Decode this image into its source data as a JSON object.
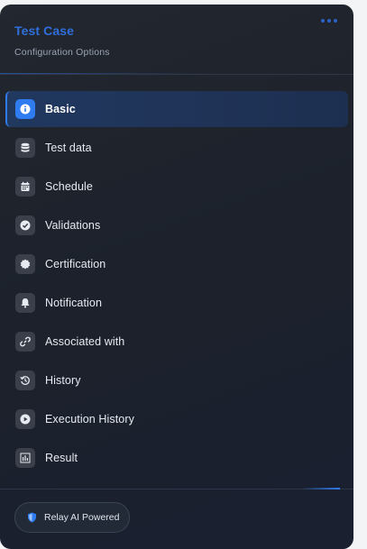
{
  "header": {
    "title": "Test Case",
    "subtitle": "Configuration Options",
    "more_icon": "more-horizontal-icon"
  },
  "menu": {
    "active_index": 0,
    "items": [
      {
        "label": "Basic",
        "icon": "info-icon"
      },
      {
        "label": "Test data",
        "icon": "database-icon"
      },
      {
        "label": "Schedule",
        "icon": "calendar-icon"
      },
      {
        "label": "Validations",
        "icon": "check-circle-icon"
      },
      {
        "label": "Certification",
        "icon": "certificate-icon"
      },
      {
        "label": "Notification",
        "icon": "bell-icon"
      },
      {
        "label": "Associated with",
        "icon": "link-icon"
      },
      {
        "label": "History",
        "icon": "history-icon"
      },
      {
        "label": "Execution History",
        "icon": "play-circle-icon"
      },
      {
        "label": "Result",
        "icon": "bar-chart-icon"
      }
    ]
  },
  "footer": {
    "badge_label": "Relay AI Powered",
    "badge_icon": "shield-icon"
  },
  "colors": {
    "accent": "#2f7bf0",
    "title": "#2f6fdc",
    "panel_bg": "#1e232c",
    "icon_bg": "#3a3f49"
  }
}
